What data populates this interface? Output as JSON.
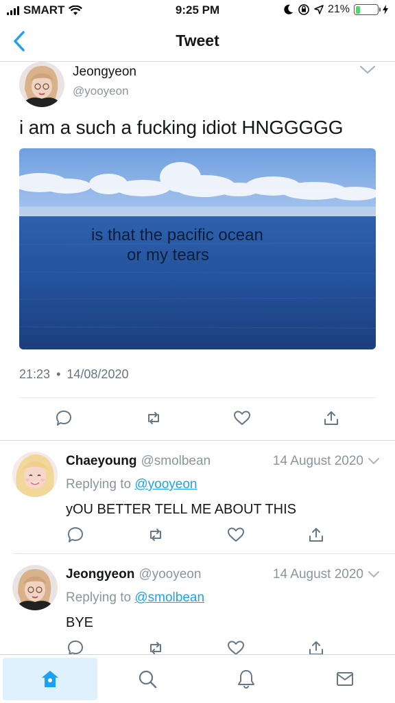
{
  "status_bar": {
    "carrier": "SMART",
    "time": "9:25 PM",
    "battery": "21%",
    "battery_level": 0.21
  },
  "nav": {
    "title": "Tweet"
  },
  "main_tweet": {
    "name": "Jeongyeon",
    "handle": "@yooyeon",
    "text": "i am a such a fucking idiot HNGGGGG",
    "media_caption_line1": "is that the pacific ocean",
    "media_caption_line2": "or my tears",
    "time": "21:23",
    "separator": "•",
    "date": "14/08/2020"
  },
  "replies": [
    {
      "name": "Chaeyoung",
      "handle": "@smolbean",
      "date": "14 August 2020",
      "replying_prefix": "Replying to",
      "replying_to": "@yooyeon",
      "text": "yOU BETTER TELL ME ABOUT THIS"
    },
    {
      "name": "Jeongyeon",
      "handle": "@yooyeon",
      "date": "14 August 2020",
      "replying_prefix": "Replying to",
      "replying_to": "@smolbean",
      "text": "BYE"
    }
  ],
  "tabs": [
    {
      "icon": "home-icon",
      "active": true
    },
    {
      "icon": "search-icon",
      "active": false
    },
    {
      "icon": "bell-icon",
      "active": false
    },
    {
      "icon": "mail-icon",
      "active": false
    }
  ],
  "colors": {
    "accent": "#1da1f2",
    "muted": "#8a959e",
    "battery_green": "#4cd964"
  }
}
